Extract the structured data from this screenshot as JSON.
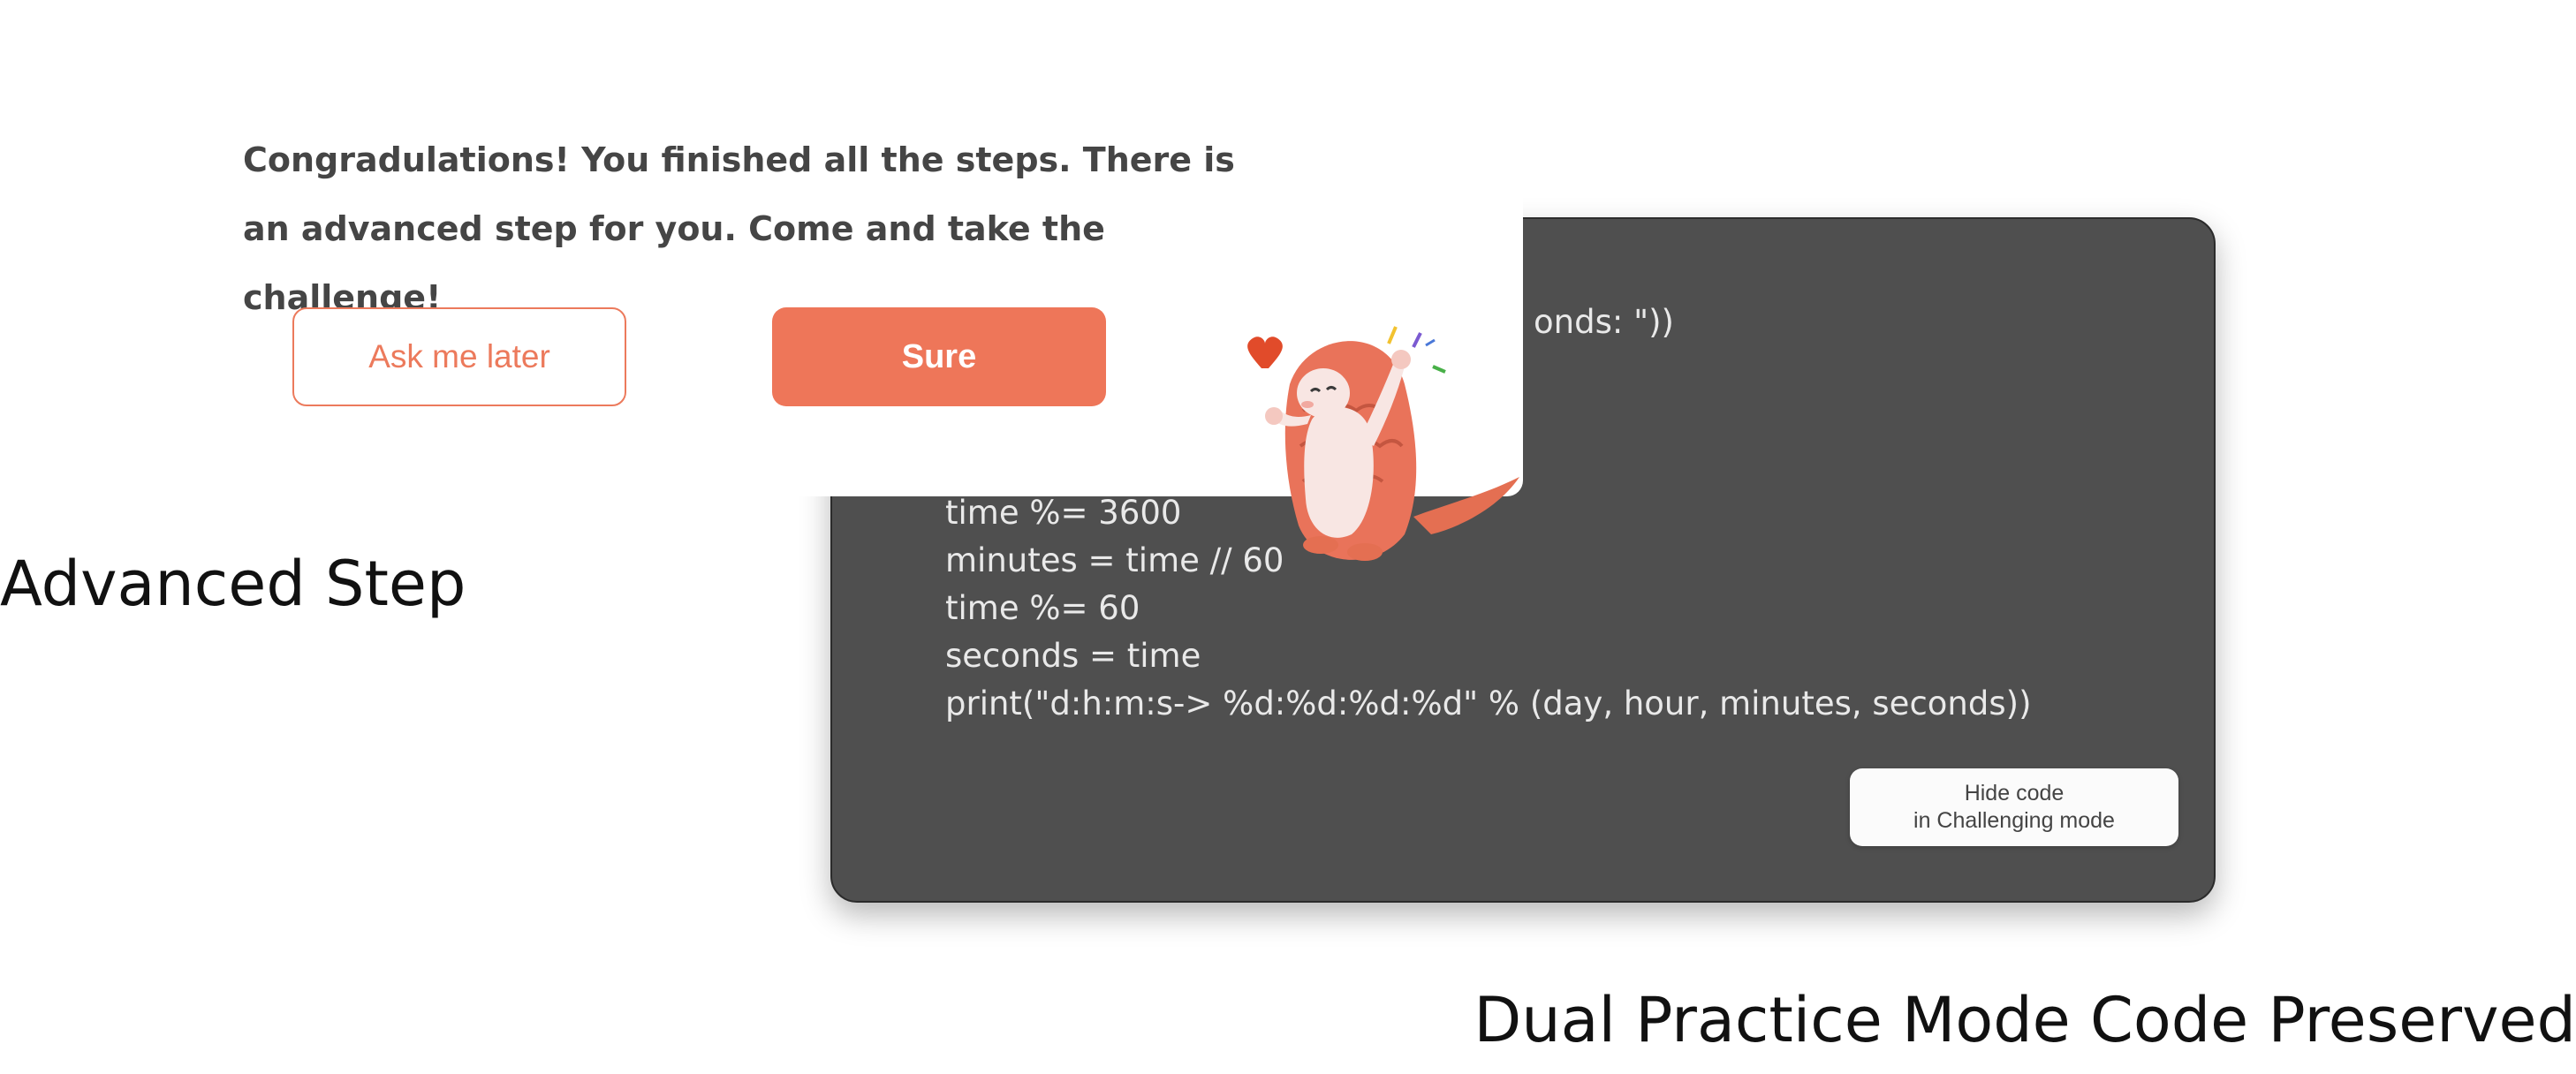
{
  "code_panel": {
    "visible_fragment": "onds: \"))",
    "lines": [
      "time %= 3600",
      "minutes = time // 60",
      "time %= 60",
      "seconds = time",
      "print(\"d:h:m:s-> %d:%d:%d:%d\" % (day, hour, minutes, seconds))"
    ],
    "hide_button": {
      "line1": "Hide code",
      "line2": "in Challenging mode"
    }
  },
  "popup": {
    "message": "Congradulations! You finished all the steps. There is an advanced step for you. Come and take the challenge!",
    "later_label": "Ask me later",
    "sure_label": "Sure"
  },
  "labels": {
    "advanced_step": "Advanced Step",
    "dual_practice": "Dual Practice Mode Code Preserved"
  },
  "colors": {
    "accent": "#ee7659",
    "code_bg": "#4f4f4f",
    "code_text": "#e9e9e9"
  },
  "icons": {
    "mascot": "pangolin-mascot-icon",
    "heart": "heart-icon"
  }
}
